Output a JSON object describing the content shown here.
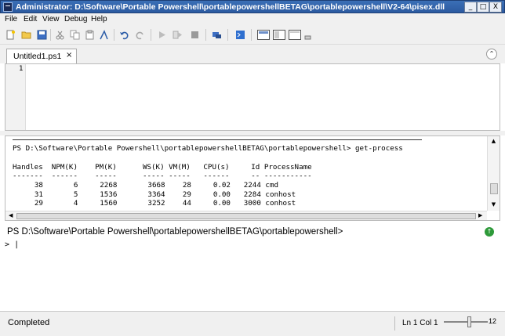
{
  "window": {
    "title": "Administrator: D:\\Software\\Portable Powershell\\portablepowershellBETAG\\portablepowershell\\V2-64\\pisex.dll",
    "minimize": "_",
    "maximize": "□",
    "close": "X"
  },
  "menu": {
    "items": [
      "File",
      "Edit",
      "View",
      "Debug",
      "Help"
    ]
  },
  "tabs": [
    {
      "label": "Untitled1.ps1",
      "close": "×"
    }
  ],
  "editor": {
    "line_number": "1"
  },
  "output": {
    "prompt_line": "PS D:\\Software\\Portable Powershell\\portablepowershellBETAG\\portablepowershell> get-process",
    "header": "Handles  NPM(K)    PM(K)      WS(K) VM(M)   CPU(s)     Id ProcessName",
    "underline": "-------  ------    -----      ----- -----   ------     -- -----------",
    "rows": [
      {
        "handles": "38",
        "npm": "6",
        "pm": "2268",
        "ws": "3668",
        "vm": "28",
        "cpu": "0.02",
        "id": "2244",
        "name": "cmd"
      },
      {
        "handles": "31",
        "npm": "5",
        "pm": "1536",
        "ws": "3364",
        "vm": "29",
        "cpu": "0.00",
        "id": "2284",
        "name": "conhost"
      },
      {
        "handles": "29",
        "npm": "4",
        "pm": "1560",
        "ws": "3252",
        "vm": "44",
        "cpu": "0.00",
        "id": "3000",
        "name": "conhost"
      }
    ]
  },
  "command": {
    "prompt": "PS D:\\Software\\Portable Powershell\\portablepowershellBETAG\\portablepowershell>",
    "input_marker": ">",
    "input_value": "|"
  },
  "status": {
    "text": "Completed",
    "position": "Ln 1  Col 1",
    "zoom": "12"
  },
  "colors": {
    "titlebar": "#2b5aa0",
    "run_button": "#2e9a3a"
  }
}
